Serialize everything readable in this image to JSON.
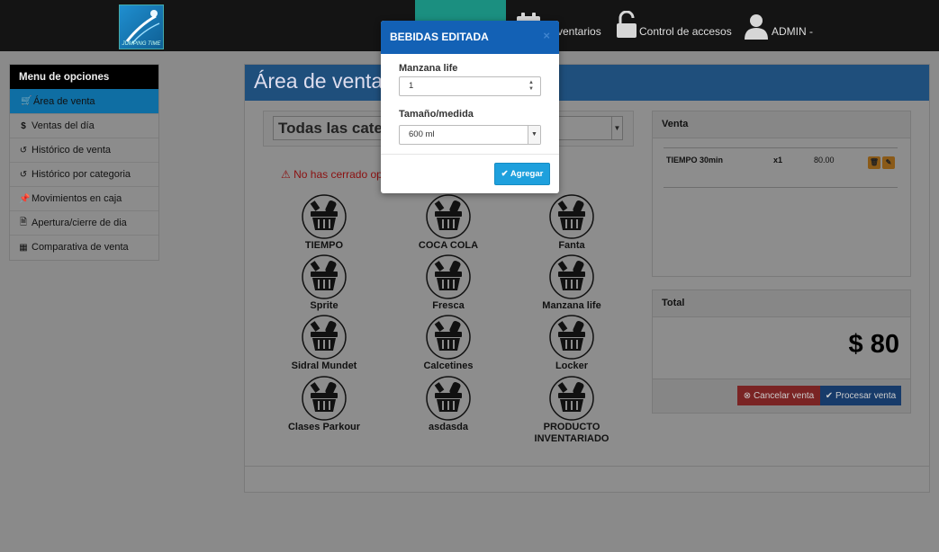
{
  "navbar": {
    "logo_text": "JUMPING TIME",
    "items": [
      {
        "label": "Inventarios",
        "label_visible": "ventarios"
      },
      {
        "label": "Control de accesos"
      },
      {
        "label": "ADMIN -"
      }
    ]
  },
  "sidebar": {
    "title": "Menu de opciones",
    "items": [
      {
        "label": "Área de venta",
        "icon": "cart-icon",
        "active": true
      },
      {
        "label": "Ventas del día",
        "icon": "dollar-icon"
      },
      {
        "label": "Histórico de venta",
        "icon": "history-icon"
      },
      {
        "label": "Histórico por categoria",
        "icon": "history-icon"
      },
      {
        "label": "Movimientos en caja",
        "icon": "pin-icon"
      },
      {
        "label": "Apertura/cierre de dia",
        "icon": "file-icon"
      },
      {
        "label": "Comparativa de venta",
        "icon": "bar-chart-icon"
      }
    ]
  },
  "main": {
    "title": "Área de venta",
    "category_select": "Todas las categ",
    "warning": "No has cerrado oper",
    "products": [
      "TIEMPO",
      "COCA COLA",
      "Fanta",
      "Sprite",
      "Fresca",
      "Manzana life",
      "Sidral Mundet",
      "Calcetines",
      "Locker",
      "Clases Parkour",
      "asdasda",
      "PRODUCTO INVENTARIADO"
    ]
  },
  "venta": {
    "title": "Venta",
    "row": {
      "name": "TIEMPO 30min",
      "qty": "x1",
      "price": "80.00"
    }
  },
  "total": {
    "title": "Total",
    "amount": "$ 80",
    "cancel_label": "Cancelar venta",
    "process_label": "Procesar venta"
  },
  "modal": {
    "title": "BEBIDAS EDITADA",
    "close": "×",
    "field1_label": "Manzana life",
    "field1_value": "1",
    "field2_label": "Tamaño/medida",
    "field2_value": "600 ml",
    "add_label": "Agregar"
  },
  "colors": {
    "modal_header": "#1361b5",
    "add_button": "#1ea0dd",
    "cancel_button": "#d9534f",
    "process_button": "#1b4f8f"
  }
}
